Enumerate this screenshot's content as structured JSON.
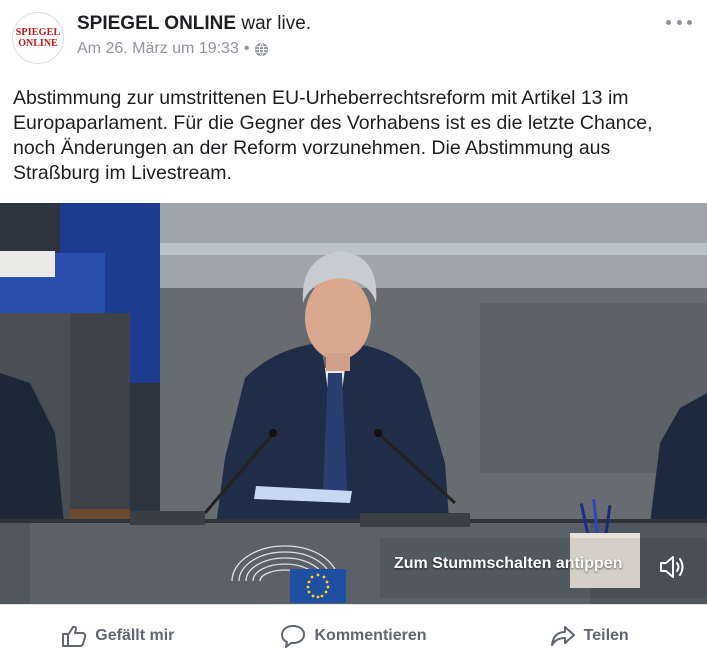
{
  "post": {
    "avatar": {
      "line1": "SPIEGEL",
      "line2": "ONLINE"
    },
    "page_name": "SPIEGEL ONLINE",
    "action_text": " war live.",
    "timestamp": "Am 26. März um 19:33",
    "separator": "•",
    "text": "Abstimmung zur umstrittenen EU-Urheberrechtsreform mit Artikel 13 im Europaparlament. Für die Gegner des Vorhabens ist es die letzte Chance, noch Änderungen an der Reform vorzunehmen. Die Abstimmung aus Straßburg im Livestream."
  },
  "video": {
    "mute_prompt": "Zum Stummschalten antippen"
  },
  "actions": {
    "like": "Gefällt mir",
    "comment": "Kommentieren",
    "share": "Teilen"
  },
  "icons": {
    "audience": "globe-icon",
    "menu": "more-options-icon",
    "sound": "speaker-icon",
    "like": "thumbs-up-icon",
    "comment": "comment-bubble-icon",
    "share": "share-arrow-icon"
  },
  "colors": {
    "brand_red": "#c4161c",
    "meta_gray": "#90949c",
    "action_gray": "#606770",
    "eu_blue": "#1f4fa0",
    "eu_star": "#ffd617"
  }
}
